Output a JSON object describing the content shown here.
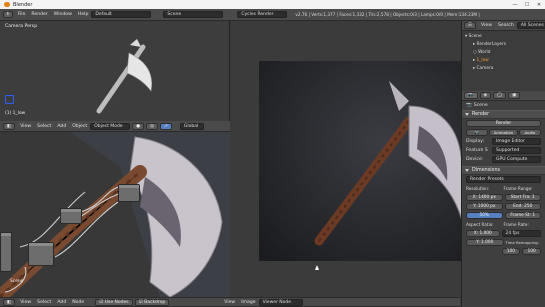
{
  "window": {
    "title": "Blender",
    "title_bar_controls": [
      "—",
      "☐",
      "✕"
    ]
  },
  "info_header": {
    "menus": [
      "File",
      "Render",
      "Window",
      "Help"
    ],
    "screen": "Default",
    "scene": "Scene",
    "engine": "Cycles Render",
    "stats": "v2.76 | Verts:1,377 | Faces:1,332 | Tris:2,578 | Objects:0/3 | Lamps:0/0 | Mem:134.23M |"
  },
  "camera_view": {
    "label": "Camera Persp",
    "object_label": "(1) 1_low"
  },
  "view3d_header": {
    "items": [
      "View",
      "Select",
      "Add",
      "Object"
    ],
    "mode": "Object Mode",
    "pivot": "Global"
  },
  "node_editor": {
    "scene_label": "Scene"
  },
  "bottom_bar": {
    "items": [
      "View",
      "Select",
      "Add",
      "Node"
    ],
    "use_nodes": "Use Nodes",
    "backdrop": "Backdrop",
    "right_items": [
      "View",
      "Image"
    ],
    "viewer": "Viewer Node"
  },
  "outliner": {
    "header": [
      "View",
      "Search",
      "All Scenes"
    ],
    "tree": [
      "Scene",
      "RenderLayers",
      "World",
      "1_low",
      "Camera"
    ]
  },
  "properties": {
    "context": "Scene",
    "render_section": "Render",
    "render_button": "Render",
    "animation_button": "Animation",
    "audio_button": "Audio",
    "display_label": "Display:",
    "display_value": "Image Editor",
    "feature_label": "Feature S",
    "feature_value": "Supported",
    "device_label": "Device:",
    "device_value": "GPU Compute",
    "dimensions_section": "Dimensions",
    "render_presets": "Render Presets",
    "resolution_label": "Resolution:",
    "frame_range_label": "Frame Range:",
    "res_x": "X: 1400 px",
    "res_y": "Y: 1000 px",
    "res_pct": "50%",
    "start_frame": "Start Fra: 1",
    "end_frame": "End: 250",
    "frame_step": "Frame St: 1",
    "aspect_label": "Aspect Ratio:",
    "frame_rate_label": "Frame Rate:",
    "aspect_x": "X: 1.000",
    "aspect_y": "Y: 1.000",
    "fps": "24 fps",
    "time_remap": "Time Remapping:",
    "remap_old": "100",
    "remap_new": "100"
  },
  "colors": {
    "bg": "#3a3a3a",
    "header": "#4a4a4a",
    "selection": "#f0a030",
    "node_wire": "#cfcfcf",
    "render_bg": "#2a2b2e"
  }
}
